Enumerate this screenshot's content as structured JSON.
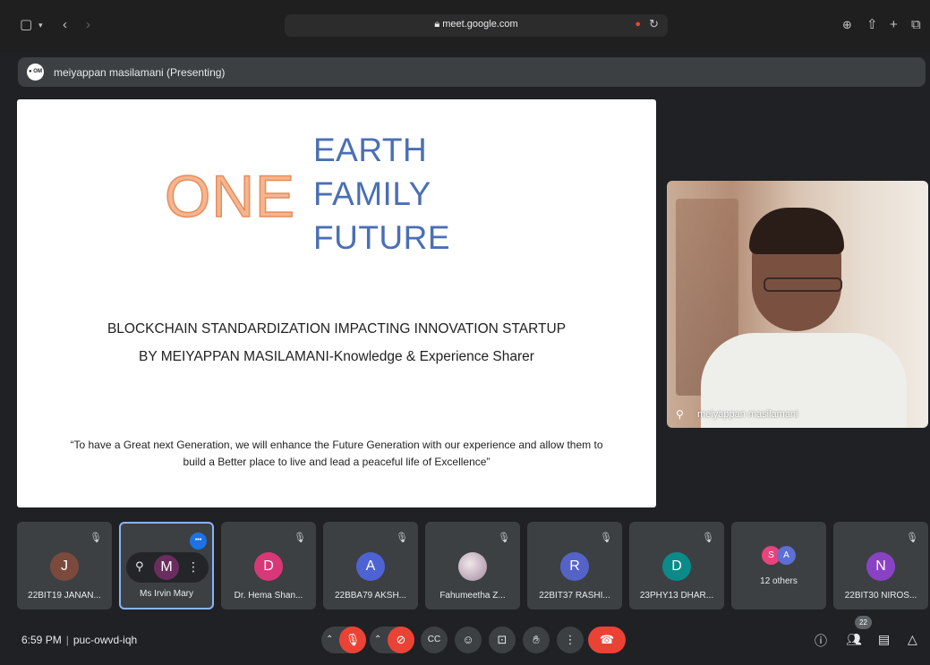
{
  "browser": {
    "url": "meet.google.com",
    "icons": [
      "sidebar-icon",
      "chevron-down-icon",
      "back-icon",
      "forward-icon",
      "lock-icon",
      "microphone-icon",
      "reload-icon",
      "download-icon",
      "share-icon",
      "new-tab-icon",
      "tabs-icon"
    ]
  },
  "presenter": {
    "avatar_text": "● OM",
    "label": "meiyappan masilamani (Presenting)"
  },
  "slide": {
    "one": "ONE",
    "earth": "EARTH",
    "family": "FAMILY",
    "future": "FUTURE",
    "line1": "BLOCKCHAIN STANDARDIZATION IMPACTING INNOVATION STARTUP",
    "line2": "BY MEIYAPPAN MASILAMANI-Knowledge & Experience Sharer",
    "quote": "“To have a Great next Generation, we will enhance the Future Generation with our experience and allow them to build a Better place to live and lead a peaceful life of Excellence”",
    "colors": {
      "one_fill": "#f4b591",
      "efw": "#4a6fb5"
    }
  },
  "video": {
    "name": "meiyappan masilamani"
  },
  "tiles": [
    {
      "avatar": "J",
      "color": "#7b4a3c",
      "name": "22BIT19 JANAN..."
    },
    {
      "avatar": "M",
      "color": "#6b2d5e",
      "name": "Ms Irvin Mary",
      "selected": true
    },
    {
      "avatar": "D",
      "color": "#d93778",
      "name": "Dr. Hema Shan..."
    },
    {
      "avatar": "A",
      "color": "#4d63d4",
      "name": "22BBA79 AKSH..."
    },
    {
      "avatar": "",
      "color": "#c9b7c7",
      "name": "Fahumeetha Z..."
    },
    {
      "avatar": "R",
      "color": "#5563c8",
      "name": "22BIT37 RASHI..."
    },
    {
      "avatar": "D",
      "color": "#0b8a8a",
      "name": "23PHY13 DHAR..."
    },
    {
      "others": true,
      "avatars": [
        {
          "t": "S",
          "c": "#e8437d"
        },
        {
          "t": "A",
          "c": "#5b6fd4"
        }
      ],
      "name": "12 others"
    },
    {
      "avatar": "N",
      "color": "#8a42c4",
      "name": "22BIT30 NIROS..."
    }
  ],
  "tile_icons": {
    "mute": "mic-off-icon",
    "pin": "pin-icon",
    "more": "more-options-icon"
  },
  "bottom": {
    "time": "6:59 PM",
    "separator": "|",
    "meeting_code": "puc-owvd-iqh",
    "participant_count": "22",
    "icons": {
      "mic": "mic-off-icon",
      "camera": "camera-off-icon",
      "captions": "captions-icon",
      "emoji": "emoji-icon",
      "present": "present-icon",
      "hand": "raise-hand-icon",
      "more": "more-icon",
      "end": "end-call-icon",
      "info": "info-icon",
      "people": "people-icon",
      "chat": "chat-icon",
      "activities": "activities-icon"
    }
  }
}
